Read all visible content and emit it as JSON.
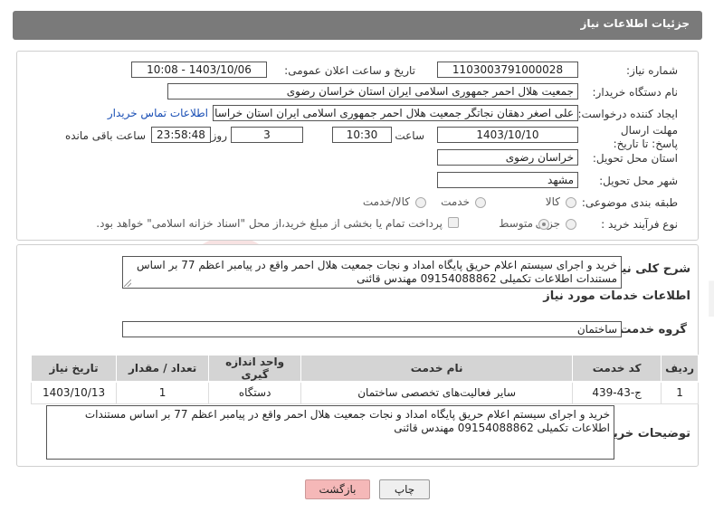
{
  "header": {
    "title": "جزئیات اطلاعات نیاز"
  },
  "fields": {
    "need_number": {
      "label": "شماره نیاز:",
      "value": "1103003791000028"
    },
    "announce": {
      "label": "تاریخ و ساعت اعلان عمومی:",
      "value": "1403/10/06 - 10:08"
    },
    "buyer_org": {
      "label": "نام دستگاه خریدار:",
      "value": "جمعیت هلال احمر جمهوری اسلامی ایران استان خراسان رضوی"
    },
    "requester": {
      "label": "ایجاد کننده درخواست:",
      "value": "علی اصغر دهقان نجاتگر جمعیت هلال احمر جمهوری اسلامی ایران استان خراسان",
      "contact_link": "اطلاعات تماس خریدار"
    },
    "deadline": {
      "label": "مهلت ارسال پاسخ: تا تاریخ:",
      "date": "1403/10/10",
      "time_label": "ساعت",
      "time": "10:30",
      "days": "3",
      "days_label": "روز و",
      "remaining": "23:58:48",
      "remaining_label": "ساعت باقی مانده"
    },
    "province": {
      "label": "استان محل تحویل:",
      "value": "خراسان رضوی"
    },
    "city": {
      "label": "شهر محل تحویل:",
      "value": "مشهد"
    },
    "category": {
      "label": "طبقه بندی موضوعی:",
      "options": [
        "کالا",
        "خدمت",
        "کالا/خدمت"
      ]
    },
    "process": {
      "label": "نوع فرآیند خرید :",
      "options": [
        "جزیی",
        "متوسط"
      ],
      "note": "پرداخت تمام یا بخشی از مبلغ خرید،از محل \"اسناد خزانه اسلامی\" خواهد بود."
    }
  },
  "summary": {
    "label": "شرح کلی نیاز:",
    "value": "خرید و اجرای سیستم اعلام حریق پایگاه امداد و نجات جمعیت هلال احمر واقع در پیامبر اعظم 77 بر اساس مستندات اطلاعات تکمیلی 09154088862 مهندس قائنی"
  },
  "services": {
    "section_title": "اطلاعات خدمات مورد نیاز",
    "group_label": "گروه خدمت:",
    "group_value": "ساختمان",
    "columns": [
      "ردیف",
      "کد خدمت",
      "نام خدمت",
      "واحد اندازه گیری",
      "تعداد / مقدار",
      "تاریخ نیاز"
    ],
    "rows": [
      [
        "1",
        "ج-43-439",
        "سایر فعالیت‌های تخصصی ساختمان",
        "دستگاه",
        "1",
        "1403/10/13"
      ]
    ]
  },
  "buyer_notes": {
    "label": "توضیحات خریدار:",
    "value": "خرید و اجرای سیستم اعلام حریق پایگاه امداد و نجات جمعیت هلال احمر واقع در پیامبر اعظم 77 بر اساس مستندات اطلاعات تکمیلی 09154088862 مهندس قائنی"
  },
  "buttons": {
    "print": "چاپ",
    "back": "بازگشت"
  },
  "watermark": {
    "text": "AriaTender.neT"
  },
  "colors": {
    "header": "#7a7a7a",
    "link": "#1a4fb5",
    "back_button": "#f5b8b8",
    "watermark": "#c62828"
  }
}
